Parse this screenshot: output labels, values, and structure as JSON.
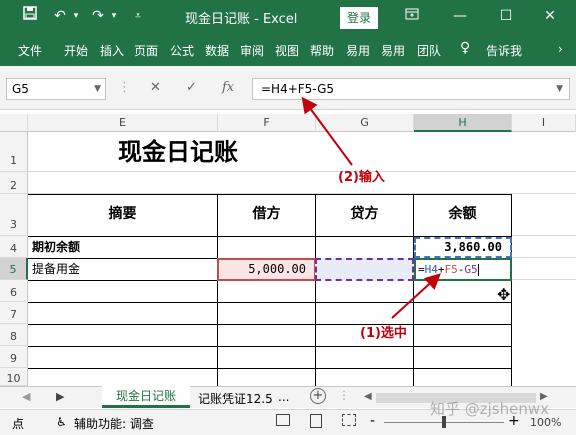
{
  "window": {
    "title": "现金日记账 - Excel",
    "login_label": "登录",
    "accent": "#217346"
  },
  "titlebar_icons": [
    "save-icon",
    "undo-icon",
    "redo-icon",
    "customize-icon",
    "ribbon-display-icon",
    "minimize-icon",
    "maximize-icon",
    "close-icon"
  ],
  "ribbon": {
    "tabs": [
      "文件",
      "开始",
      "插入",
      "页面",
      "公式",
      "数据",
      "审阅",
      "视图",
      "帮助",
      "易用",
      "易用",
      "团队"
    ],
    "tell_me": "告诉我"
  },
  "formula_bar": {
    "name_box": "G5",
    "cancel": "✕",
    "enter": "✓",
    "fx": "fx",
    "formula": "=H4+F5-G5"
  },
  "columns": [
    "E",
    "F",
    "G",
    "H",
    "I"
  ],
  "rows": [
    "1",
    "2",
    "3",
    "4",
    "5",
    "6",
    "7",
    "8",
    "9",
    "10"
  ],
  "sheet": {
    "title": "现金日记账",
    "headers": [
      "摘要",
      "借方",
      "贷方",
      "余额"
    ],
    "row4": {
      "summary": "期初余额",
      "balance": "3,860.00"
    },
    "row5": {
      "summary": "提备用金",
      "debit": "5,000.00",
      "balance_formula": "=H4+F5-G5"
    }
  },
  "annotations": {
    "input": "(2)输入",
    "select": "(1)选中"
  },
  "sheet_tabs": [
    "现金日记账",
    "记账凭证12.5"
  ],
  "tab_more": "...",
  "add_sheet": "+",
  "status": {
    "mode": "点",
    "accessibility": "辅助功能: 调查",
    "zoom": "100%",
    "zoom_minus": "-",
    "zoom_plus": "+"
  },
  "watermark": "知乎 @zjshenwx"
}
